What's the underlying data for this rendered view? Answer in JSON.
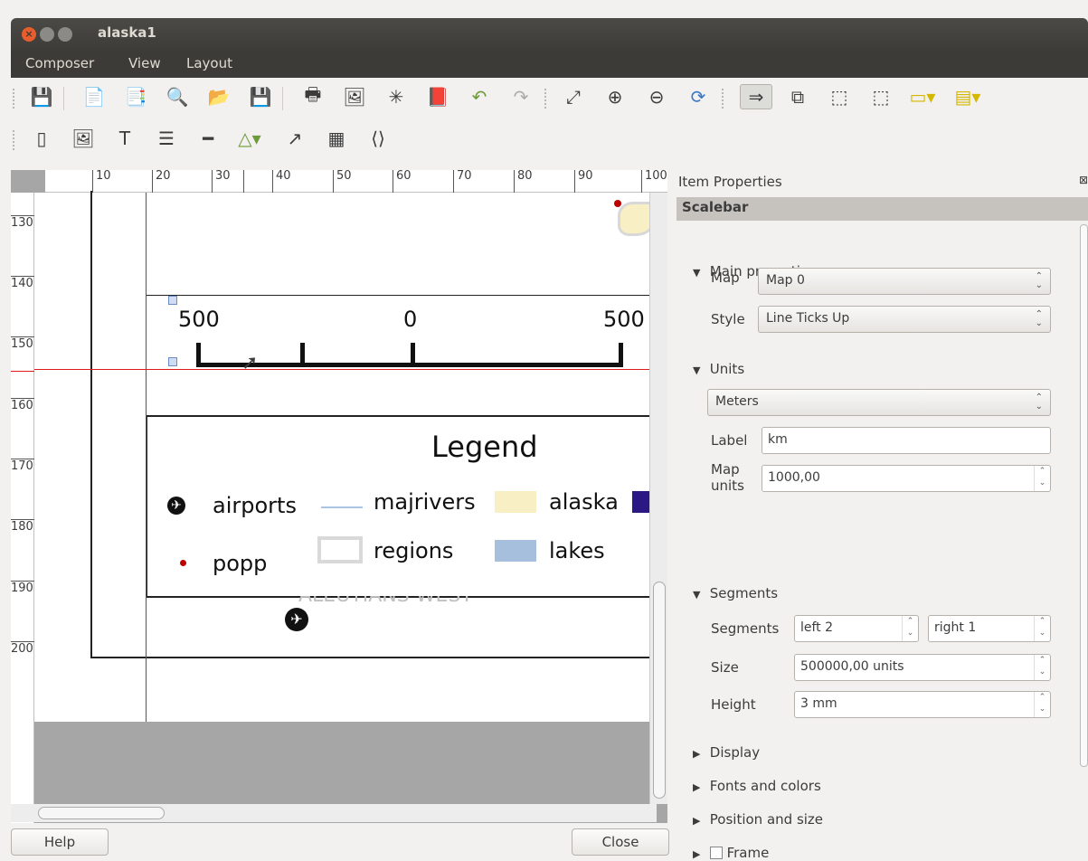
{
  "window": {
    "title": "alaska1"
  },
  "menu": [
    "Composer",
    "View",
    "Layout"
  ],
  "ruler": {
    "h": [
      "10",
      "20",
      "30",
      "40",
      "50",
      "60",
      "70",
      "80",
      "90",
      "100"
    ],
    "v": [
      "130",
      "140",
      "150",
      "160",
      "170",
      "180",
      "190",
      "200"
    ]
  },
  "scalebar_preview": {
    "left": "500",
    "mid": "0",
    "right": "500"
  },
  "legend": {
    "title": "Legend",
    "items": [
      "airports",
      "majrivers",
      "alaska",
      "popp",
      "regions",
      "lakes"
    ],
    "map_label": "ALEUTIANS WEST"
  },
  "panel": {
    "header": "Item Properties",
    "item": "Scalebar",
    "main": {
      "title": "Main properties",
      "map_label": "Map",
      "map_value": "Map 0",
      "style_label": "Style",
      "style_value": "Line Ticks Up"
    },
    "units": {
      "title": "Units",
      "unit_value": "Meters",
      "label_label": "Label",
      "label_value": "km",
      "mapunits_label": "Map\nunits",
      "mapunits_value": "1000,00"
    },
    "segments": {
      "title": "Segments",
      "seg_label": "Segments",
      "left_value": "left 2",
      "right_value": "right 1",
      "size_label": "Size",
      "size_value": "500000,00 units",
      "height_label": "Height",
      "height_value": "3 mm"
    },
    "collapsed": [
      "Display",
      "Fonts and colors",
      "Position and size",
      "Frame"
    ]
  },
  "buttons": {
    "help": "Help",
    "close": "Close"
  },
  "colors": {
    "titlebar": "#3c3b37",
    "close_btn": "#e85d2d",
    "red_guide": "#e01b1b",
    "river": "#a9c4e4",
    "alaska": "#f9efc4",
    "lakes": "#a6bfdd",
    "region_dark": "#2b1885"
  }
}
